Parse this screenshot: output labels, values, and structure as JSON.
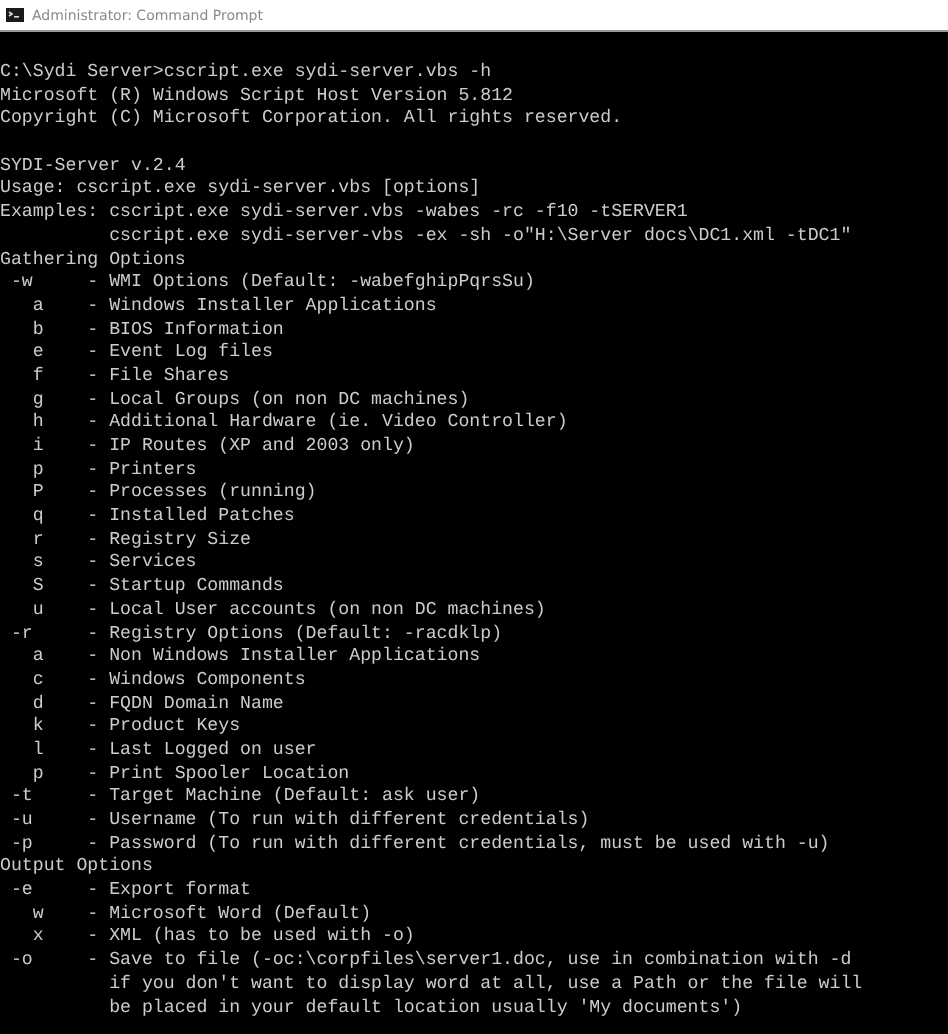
{
  "window": {
    "title": "Administrator: Command Prompt"
  },
  "console": {
    "blocks": [
      {
        "lines": [
          "C:\\Sydi Server>cscript.exe sydi-server.vbs -h",
          "Microsoft (R) Windows Script Host Version 5.812",
          "Copyright (C) Microsoft Corporation. All rights reserved."
        ]
      },
      {
        "lines": [
          "SYDI-Server v.2.4",
          "Usage: cscript.exe sydi-server.vbs [options]",
          "Examples: cscript.exe sydi-server.vbs -wabes -rc -f10 -tSERVER1",
          "          cscript.exe sydi-server-vbs -ex -sh -o\"H:\\Server docs\\DC1.xml -tDC1\"",
          "Gathering Options",
          " -w     - WMI Options (Default: -wabefghipPqrsSu)",
          "   a    - Windows Installer Applications",
          "   b    - BIOS Information",
          "   e    - Event Log files",
          "   f    - File Shares",
          "   g    - Local Groups (on non DC machines)",
          "   h    - Additional Hardware (ie. Video Controller)",
          "   i    - IP Routes (XP and 2003 only)",
          "   p    - Printers",
          "   P    - Processes (running)",
          "   q    - Installed Patches",
          "   r    - Registry Size",
          "   s    - Services",
          "   S    - Startup Commands",
          "   u    - Local User accounts (on non DC machines)",
          " -r     - Registry Options (Default: -racdklp)",
          "   a    - Non Windows Installer Applications",
          "   c    - Windows Components",
          "   d    - FQDN Domain Name",
          "   k    - Product Keys",
          "   l    - Last Logged on user",
          "   p    - Print Spooler Location",
          " -t     - Target Machine (Default: ask user)",
          " -u     - Username (To run with different credentials)",
          " -p     - Password (To run with different credentials, must be used with -u)",
          "Output Options",
          " -e     - Export format",
          "   w    - Microsoft Word (Default)",
          "   x    - XML (has to be used with -o)",
          " -o     - Save to file (-oc:\\corpfiles\\server1.doc, use in combination with -d",
          "          if you don't want to display word at all, use a Path or the file will",
          "          be placed in your default location usually 'My documents')"
        ]
      }
    ]
  }
}
